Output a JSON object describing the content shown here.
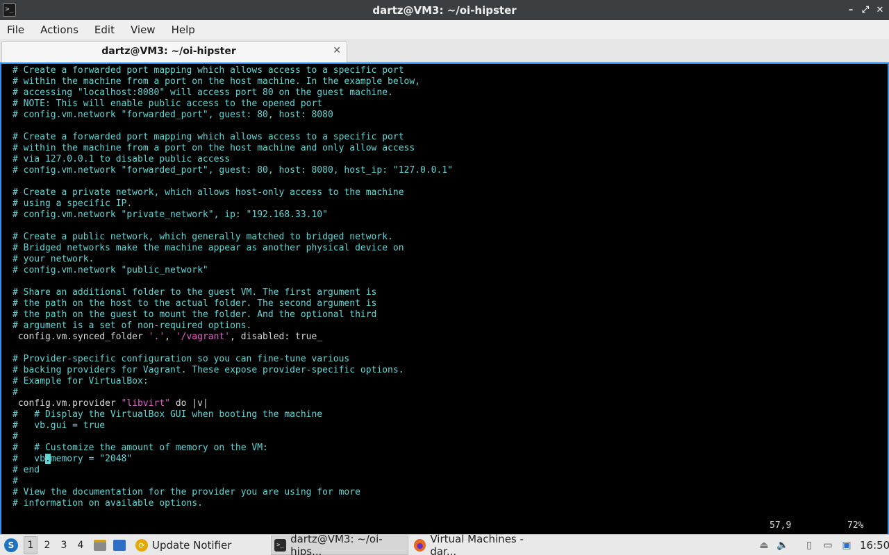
{
  "window": {
    "title": "dartz@VM3: ~/oi-hipster",
    "app_icon": ">_",
    "controls": {
      "minimize": "–",
      "restore": "⤢",
      "close": "✕"
    }
  },
  "menu": [
    "File",
    "Actions",
    "Edit",
    "View",
    "Help"
  ],
  "tab": {
    "label": "dartz@VM3: ~/oi-hipster",
    "close": "✕"
  },
  "terminal": {
    "lines": [
      [
        [
          "c",
          "# Create a forwarded port mapping which allows access to a specific port"
        ]
      ],
      [
        [
          "c",
          "# within the machine from a port on the host machine. In the example below,"
        ]
      ],
      [
        [
          "c",
          "# accessing \"localhost:8080\" will access port 80 on the guest machine."
        ]
      ],
      [
        [
          "c",
          "# NOTE: This will enable public access to the opened port"
        ]
      ],
      [
        [
          "c",
          "# config.vm.network \"forwarded_port\", guest: 80, host: 8080"
        ]
      ],
      [],
      [
        [
          "c",
          "# Create a forwarded port mapping which allows access to a specific port"
        ]
      ],
      [
        [
          "c",
          "# within the machine from a port on the host machine and only allow access"
        ]
      ],
      [
        [
          "c",
          "# via 127.0.0.1 to disable public access"
        ]
      ],
      [
        [
          "c",
          "# config.vm.network \"forwarded_port\", guest: 80, host: 8080, host_ip: \"127.0.0.1\""
        ]
      ],
      [],
      [
        [
          "c",
          "# Create a private network, which allows host-only access to the machine"
        ]
      ],
      [
        [
          "c",
          "# using a specific IP."
        ]
      ],
      [
        [
          "c",
          "# config.vm.network \"private_network\", ip: \"192.168.33.10\""
        ]
      ],
      [],
      [
        [
          "c",
          "# Create a public network, which generally matched to bridged network."
        ]
      ],
      [
        [
          "c",
          "# Bridged networks make the machine appear as another physical device on"
        ]
      ],
      [
        [
          "c",
          "# your network."
        ]
      ],
      [
        [
          "c",
          "# config.vm.network \"public_network\""
        ]
      ],
      [],
      [
        [
          "c",
          "# Share an additional folder to the guest VM. The first argument is"
        ]
      ],
      [
        [
          "c",
          "# the path on the host to the actual folder. The second argument is"
        ]
      ],
      [
        [
          "c",
          "# the path on the guest to mount the folder. And the optional third"
        ]
      ],
      [
        [
          "c",
          "# argument is a set of non-required options."
        ]
      ],
      [
        [
          "n",
          " config.vm.synced_folder "
        ],
        [
          "s",
          "'.'"
        ],
        [
          "n",
          ", "
        ],
        [
          "s",
          "'/vagrant'"
        ],
        [
          "n",
          ", disabled: true_"
        ]
      ],
      [],
      [
        [
          "c",
          "# Provider-specific configuration so you can fine-tune various"
        ]
      ],
      [
        [
          "c",
          "# backing providers for Vagrant. These expose provider-specific options."
        ]
      ],
      [
        [
          "c",
          "# Example for VirtualBox:"
        ]
      ],
      [
        [
          "c",
          "#"
        ]
      ],
      [
        [
          "n",
          " config.vm.provider "
        ],
        [
          "s",
          "\"libvirt\""
        ],
        [
          "n",
          " do |v|"
        ]
      ],
      [
        [
          "c",
          "#   # Display the VirtualBox GUI when booting the machine"
        ]
      ],
      [
        [
          "c",
          "#   vb.gui = true"
        ]
      ],
      [
        [
          "c",
          "#"
        ]
      ],
      [
        [
          "c",
          "#   # Customize the amount of memory on the VM:"
        ]
      ],
      [
        [
          "c",
          "#   vb"
        ],
        [
          "cursor",
          "."
        ],
        [
          "c",
          "memory = \"2048\""
        ]
      ],
      [
        [
          "c",
          "# end"
        ]
      ],
      [
        [
          "c",
          "#"
        ]
      ],
      [
        [
          "c",
          "# View the documentation for the provider you are using for more"
        ]
      ],
      [
        [
          "c",
          "# information on available options."
        ]
      ]
    ],
    "position": "57,9",
    "percent": "72%"
  },
  "taskbar": {
    "workspaces": [
      "1",
      "2",
      "3",
      "4"
    ],
    "tasks": [
      {
        "name": "task-update-notifier",
        "label": "Update Notifier",
        "icon": "update-notifier-icon",
        "glyph": "⟳",
        "color": "#e6a800"
      },
      {
        "name": "task-terminal",
        "label": "dartz@VM3: ~/oi-hips...",
        "icon": "terminal-icon",
        "glyph": ">_",
        "color": "#2b2b2b"
      },
      {
        "name": "task-virtual-machines",
        "label": "Virtual Machines - dar...",
        "icon": "firefox-icon",
        "glyph": "●",
        "color": "#e8691f"
      }
    ],
    "clock": "16:50"
  }
}
